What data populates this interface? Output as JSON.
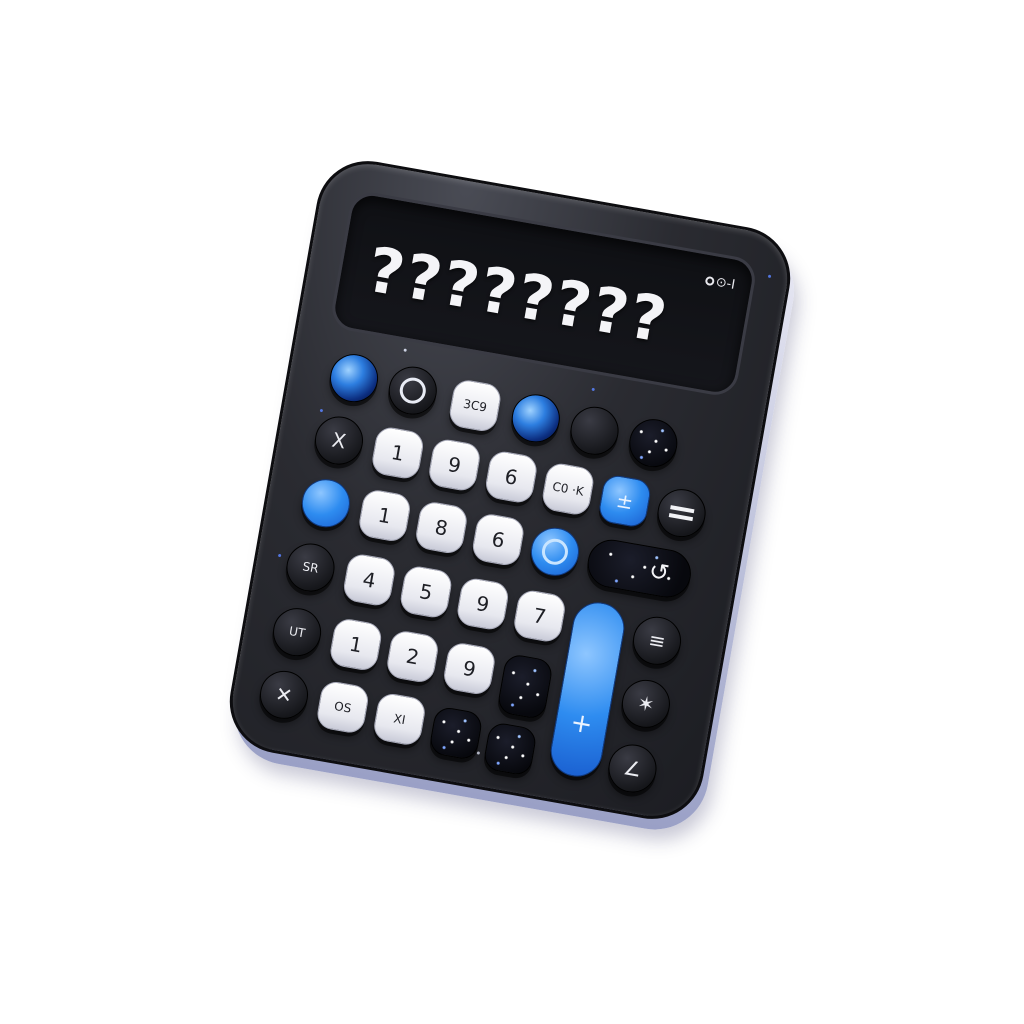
{
  "display": {
    "value": "????????",
    "indicator": "⊙-I"
  },
  "keys": {
    "row1": [
      "",
      "",
      "3C9",
      "",
      "",
      ""
    ],
    "row2": [
      "X",
      "1",
      "9",
      "6",
      "C0 ·K",
      "±",
      ""
    ],
    "row3": [
      "",
      "1",
      "8",
      "6",
      "",
      "↺"
    ],
    "row4": [
      "SR",
      "4",
      "5",
      "9",
      "7",
      "≡"
    ],
    "row5": [
      "UT",
      "1",
      "2",
      "9",
      "",
      "+"
    ],
    "row6": [
      "✕",
      "OS",
      "XI",
      "",
      "",
      "✶",
      "∠"
    ]
  },
  "colors": {
    "accent": "#2e8cf0",
    "body": "#1c1d22",
    "key_light": "#e7e8ef"
  }
}
